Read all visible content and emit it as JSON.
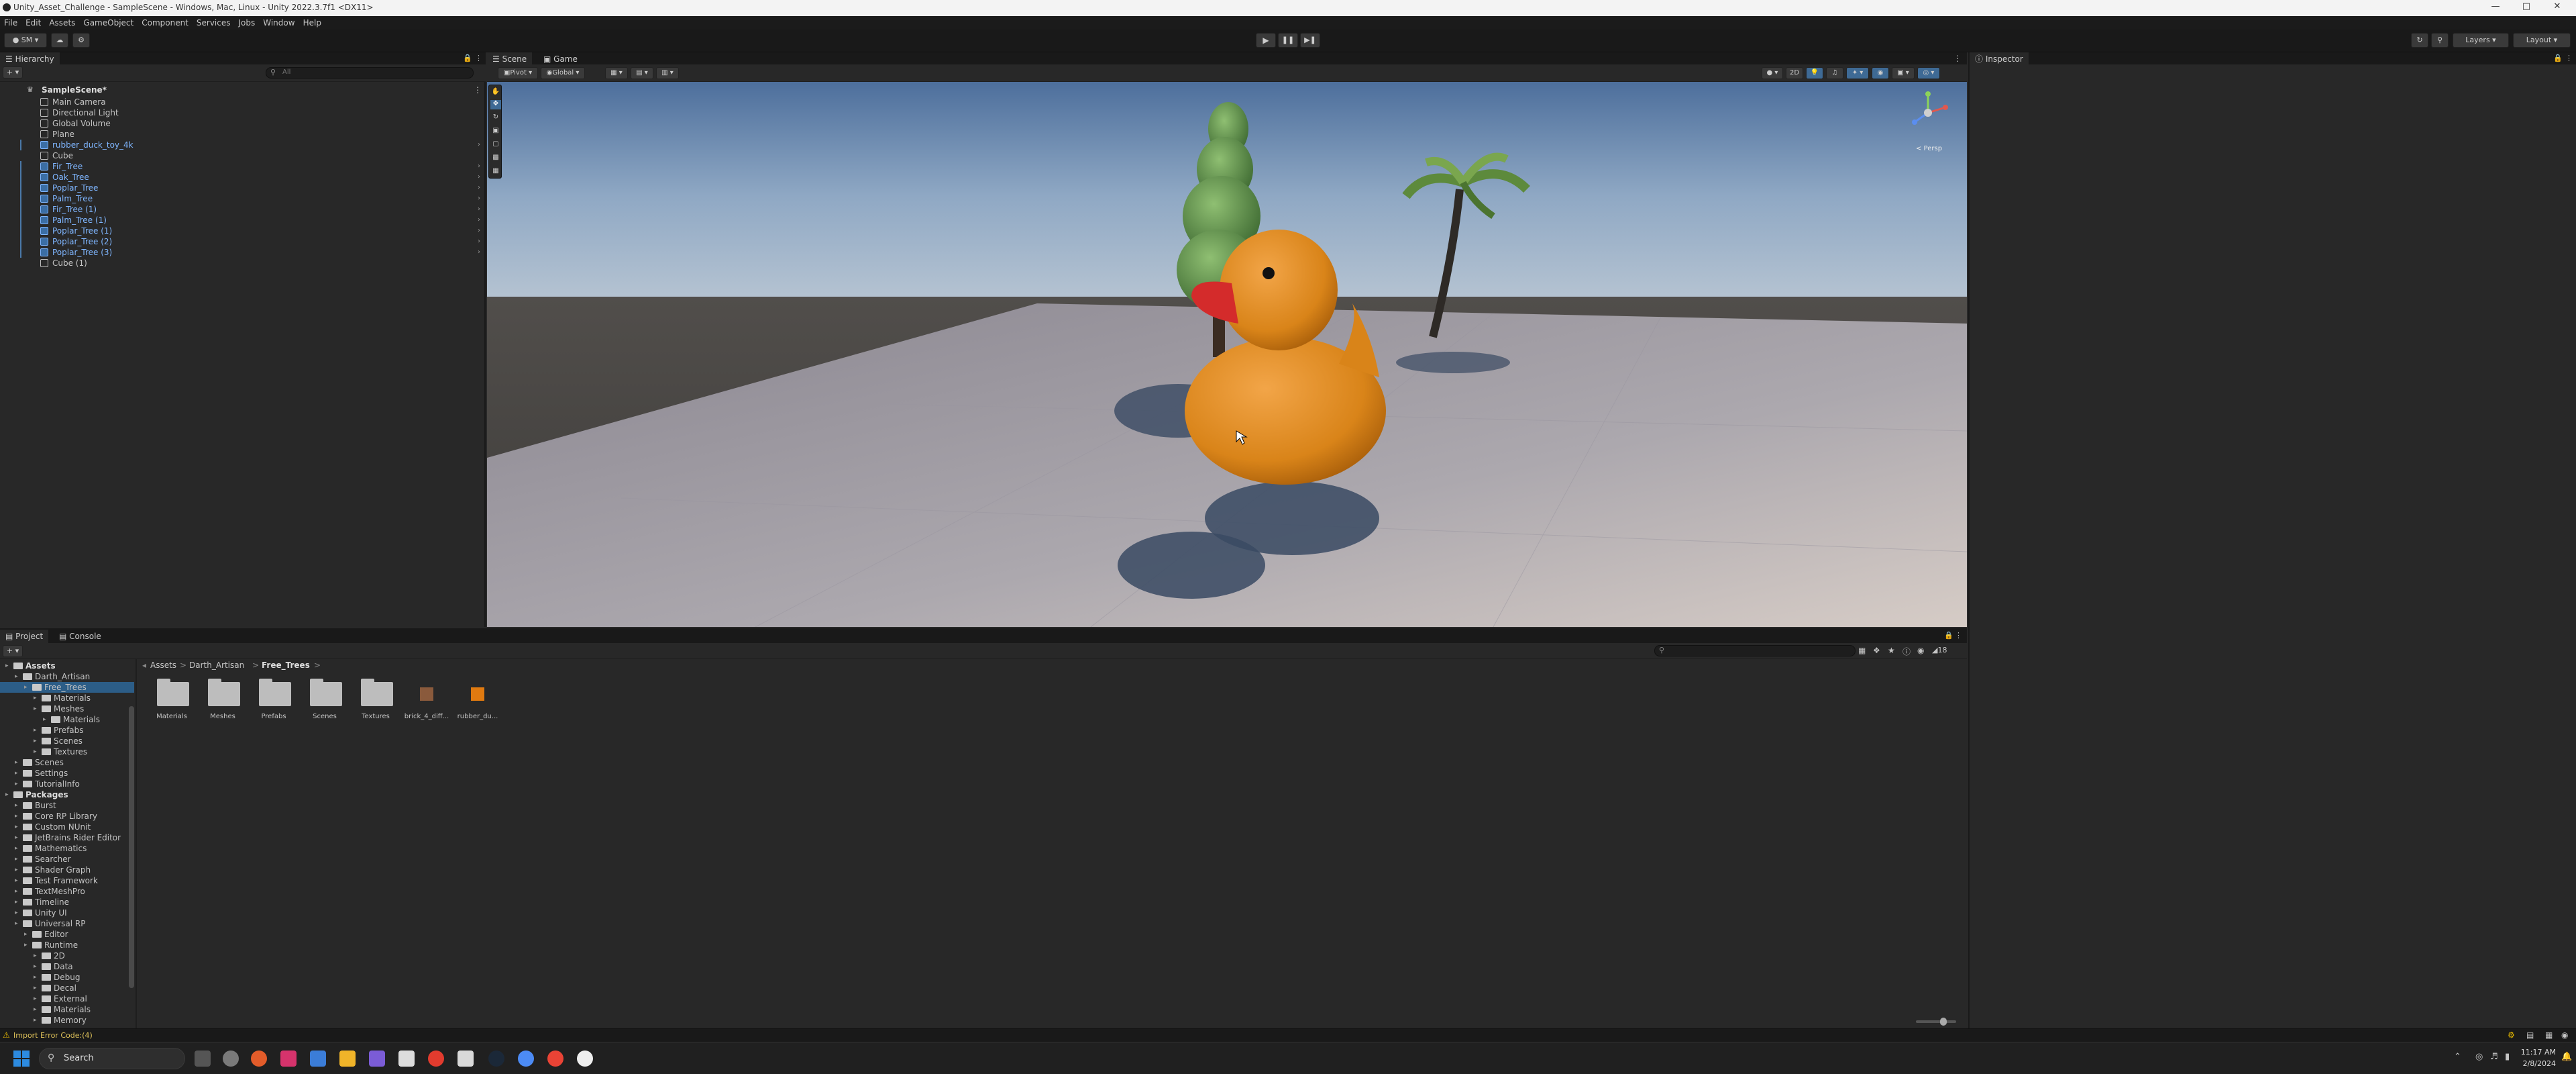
{
  "window": {
    "title": "Unity_Asset_Challenge - SampleScene - Windows, Mac, Linux - Unity 2022.3.7f1 <DX11>"
  },
  "menu": [
    "File",
    "Edit",
    "Assets",
    "GameObject",
    "Component",
    "Services",
    "Jobs",
    "Window",
    "Help"
  ],
  "toolbar": {
    "account": "SM",
    "layers": "Layers",
    "layout": "Layout"
  },
  "hierarchy": {
    "tab": "Hierarchy",
    "search_placeholder": "All",
    "scene": "SampleScene*",
    "items": [
      {
        "name": "Main Camera",
        "prefab": false
      },
      {
        "name": "Directional Light",
        "prefab": false
      },
      {
        "name": "Global Volume",
        "prefab": false
      },
      {
        "name": "Plane",
        "prefab": false
      },
      {
        "name": "rubber_duck_toy_4k",
        "prefab": true
      },
      {
        "name": "Cube",
        "prefab": false
      },
      {
        "name": "Fir_Tree",
        "prefab": true
      },
      {
        "name": "Oak_Tree",
        "prefab": true
      },
      {
        "name": "Poplar_Tree",
        "prefab": true
      },
      {
        "name": "Palm_Tree",
        "prefab": true
      },
      {
        "name": "Fir_Tree (1)",
        "prefab": true
      },
      {
        "name": "Palm_Tree (1)",
        "prefab": true
      },
      {
        "name": "Poplar_Tree (1)",
        "prefab": true
      },
      {
        "name": "Poplar_Tree (2)",
        "prefab": true
      },
      {
        "name": "Poplar_Tree (3)",
        "prefab": true
      },
      {
        "name": "Cube (1)",
        "prefab": false
      }
    ]
  },
  "scene": {
    "tabs": [
      "Scene",
      "Game"
    ],
    "pivot": "Pivot",
    "global": "Global",
    "gizmo_label": "< Persp",
    "view2d": "2D"
  },
  "inspector": {
    "tab": "Inspector"
  },
  "project": {
    "tabs": [
      "Project",
      "Console"
    ],
    "breadcrumb": [
      "Assets",
      "Darth_Artisan",
      "Free_Trees"
    ],
    "tree": [
      {
        "label": "Assets",
        "indent": 0,
        "bold": true
      },
      {
        "label": "Darth_Artisan",
        "indent": 1
      },
      {
        "label": "Free_Trees",
        "indent": 2,
        "selected": true
      },
      {
        "label": "Materials",
        "indent": 3
      },
      {
        "label": "Meshes",
        "indent": 3
      },
      {
        "label": "Materials",
        "indent": 4
      },
      {
        "label": "Prefabs",
        "indent": 3
      },
      {
        "label": "Scenes",
        "indent": 3
      },
      {
        "label": "Textures",
        "indent": 3
      },
      {
        "label": "Scenes",
        "indent": 1
      },
      {
        "label": "Settings",
        "indent": 1
      },
      {
        "label": "TutorialInfo",
        "indent": 1
      },
      {
        "label": "Packages",
        "indent": 0,
        "bold": true
      },
      {
        "label": "Burst",
        "indent": 1
      },
      {
        "label": "Core RP Library",
        "indent": 1
      },
      {
        "label": "Custom NUnit",
        "indent": 1
      },
      {
        "label": "JetBrains Rider Editor",
        "indent": 1
      },
      {
        "label": "Mathematics",
        "indent": 1
      },
      {
        "label": "Searcher",
        "indent": 1
      },
      {
        "label": "Shader Graph",
        "indent": 1
      },
      {
        "label": "Test Framework",
        "indent": 1
      },
      {
        "label": "TextMeshPro",
        "indent": 1
      },
      {
        "label": "Timeline",
        "indent": 1
      },
      {
        "label": "Unity UI",
        "indent": 1
      },
      {
        "label": "Universal RP",
        "indent": 1
      },
      {
        "label": "Editor",
        "indent": 2
      },
      {
        "label": "Runtime",
        "indent": 2
      },
      {
        "label": "2D",
        "indent": 3
      },
      {
        "label": "Data",
        "indent": 3
      },
      {
        "label": "Debug",
        "indent": 3
      },
      {
        "label": "Decal",
        "indent": 3
      },
      {
        "label": "External",
        "indent": 3
      },
      {
        "label": "Materials",
        "indent": 3
      },
      {
        "label": "Memory",
        "indent": 3
      }
    ],
    "assets": [
      {
        "label": "Materials",
        "kind": "folder"
      },
      {
        "label": "Meshes",
        "kind": "folder"
      },
      {
        "label": "Prefabs",
        "kind": "folder"
      },
      {
        "label": "Scenes",
        "kind": "folder"
      },
      {
        "label": "Textures",
        "kind": "folder"
      },
      {
        "label": "brick_4_diff...",
        "kind": "texture",
        "color": "#8a5a3c"
      },
      {
        "label": "rubber_du...",
        "kind": "texture",
        "color": "#e07a10"
      }
    ],
    "asset_count": "18"
  },
  "status": {
    "error": "Import Error Code:(4)"
  },
  "taskbar": {
    "search": "Search",
    "time": "11:17 AM",
    "date": "2/8/2024"
  },
  "colors": {
    "accent": "#2c5d87",
    "prefab_text": "#7fb6ff",
    "duck": "#e08a1e",
    "beak": "#d42b2b"
  }
}
